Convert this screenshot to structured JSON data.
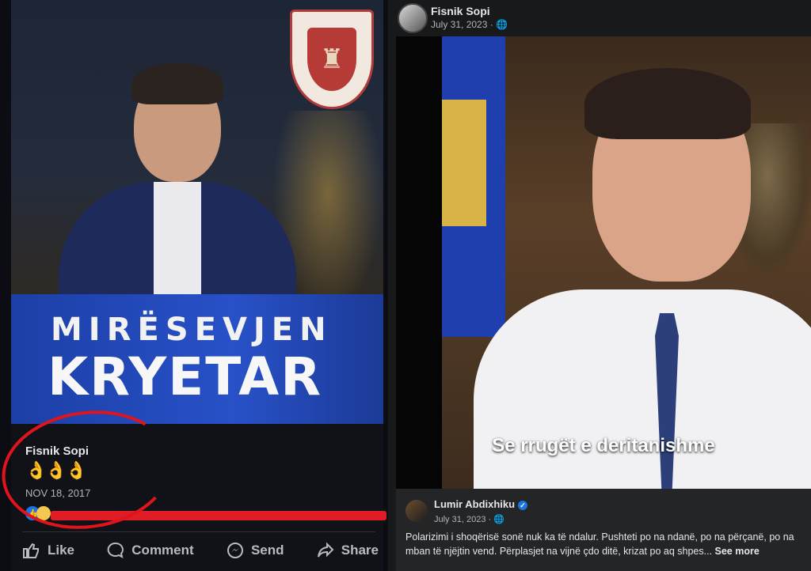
{
  "left_post": {
    "banner_line1": "MIRËSEVJEN",
    "banner_line2": "KRYETAR",
    "author": "Fisnik Sopi",
    "emojis": "👌👌👌",
    "date": "NOV 18, 2017",
    "actions": {
      "like": "Like",
      "comment": "Comment",
      "send": "Send",
      "share": "Share"
    },
    "colors": {
      "banner": "#2851c8",
      "annotation_circle": "#e0141b"
    }
  },
  "right_post": {
    "author": "Fisnik Sopi",
    "date": "July 31, 2023 · ",
    "video_caption": "Se rrugët e deritanishme",
    "shared": {
      "author": "Lumir Abdixhiku",
      "date": "July 31, 2023 · ",
      "text": "Polarizimi i shoqërisë sonë nuk ka të ndalur. Pushteti po na ndanë, po na përçanë, po na mban të njëjtin vend. Përplasjet na vijnë çdo ditë, krizat po aq shpes...",
      "see_more": "See more"
    }
  }
}
